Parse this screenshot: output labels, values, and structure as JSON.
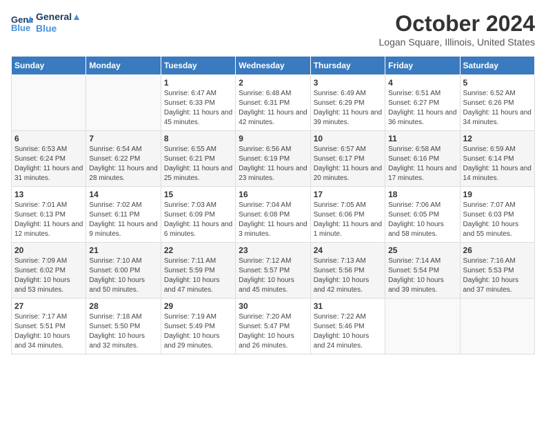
{
  "header": {
    "logo_line1": "General",
    "logo_line2": "Blue",
    "month": "October 2024",
    "location": "Logan Square, Illinois, United States"
  },
  "days_of_week": [
    "Sunday",
    "Monday",
    "Tuesday",
    "Wednesday",
    "Thursday",
    "Friday",
    "Saturday"
  ],
  "weeks": [
    [
      {
        "day": "",
        "info": ""
      },
      {
        "day": "",
        "info": ""
      },
      {
        "day": "1",
        "info": "Sunrise: 6:47 AM\nSunset: 6:33 PM\nDaylight: 11 hours and 45 minutes."
      },
      {
        "day": "2",
        "info": "Sunrise: 6:48 AM\nSunset: 6:31 PM\nDaylight: 11 hours and 42 minutes."
      },
      {
        "day": "3",
        "info": "Sunrise: 6:49 AM\nSunset: 6:29 PM\nDaylight: 11 hours and 39 minutes."
      },
      {
        "day": "4",
        "info": "Sunrise: 6:51 AM\nSunset: 6:27 PM\nDaylight: 11 hours and 36 minutes."
      },
      {
        "day": "5",
        "info": "Sunrise: 6:52 AM\nSunset: 6:26 PM\nDaylight: 11 hours and 34 minutes."
      }
    ],
    [
      {
        "day": "6",
        "info": "Sunrise: 6:53 AM\nSunset: 6:24 PM\nDaylight: 11 hours and 31 minutes."
      },
      {
        "day": "7",
        "info": "Sunrise: 6:54 AM\nSunset: 6:22 PM\nDaylight: 11 hours and 28 minutes."
      },
      {
        "day": "8",
        "info": "Sunrise: 6:55 AM\nSunset: 6:21 PM\nDaylight: 11 hours and 25 minutes."
      },
      {
        "day": "9",
        "info": "Sunrise: 6:56 AM\nSunset: 6:19 PM\nDaylight: 11 hours and 23 minutes."
      },
      {
        "day": "10",
        "info": "Sunrise: 6:57 AM\nSunset: 6:17 PM\nDaylight: 11 hours and 20 minutes."
      },
      {
        "day": "11",
        "info": "Sunrise: 6:58 AM\nSunset: 6:16 PM\nDaylight: 11 hours and 17 minutes."
      },
      {
        "day": "12",
        "info": "Sunrise: 6:59 AM\nSunset: 6:14 PM\nDaylight: 11 hours and 14 minutes."
      }
    ],
    [
      {
        "day": "13",
        "info": "Sunrise: 7:01 AM\nSunset: 6:13 PM\nDaylight: 11 hours and 12 minutes."
      },
      {
        "day": "14",
        "info": "Sunrise: 7:02 AM\nSunset: 6:11 PM\nDaylight: 11 hours and 9 minutes."
      },
      {
        "day": "15",
        "info": "Sunrise: 7:03 AM\nSunset: 6:09 PM\nDaylight: 11 hours and 6 minutes."
      },
      {
        "day": "16",
        "info": "Sunrise: 7:04 AM\nSunset: 6:08 PM\nDaylight: 11 hours and 3 minutes."
      },
      {
        "day": "17",
        "info": "Sunrise: 7:05 AM\nSunset: 6:06 PM\nDaylight: 11 hours and 1 minute."
      },
      {
        "day": "18",
        "info": "Sunrise: 7:06 AM\nSunset: 6:05 PM\nDaylight: 10 hours and 58 minutes."
      },
      {
        "day": "19",
        "info": "Sunrise: 7:07 AM\nSunset: 6:03 PM\nDaylight: 10 hours and 55 minutes."
      }
    ],
    [
      {
        "day": "20",
        "info": "Sunrise: 7:09 AM\nSunset: 6:02 PM\nDaylight: 10 hours and 53 minutes."
      },
      {
        "day": "21",
        "info": "Sunrise: 7:10 AM\nSunset: 6:00 PM\nDaylight: 10 hours and 50 minutes."
      },
      {
        "day": "22",
        "info": "Sunrise: 7:11 AM\nSunset: 5:59 PM\nDaylight: 10 hours and 47 minutes."
      },
      {
        "day": "23",
        "info": "Sunrise: 7:12 AM\nSunset: 5:57 PM\nDaylight: 10 hours and 45 minutes."
      },
      {
        "day": "24",
        "info": "Sunrise: 7:13 AM\nSunset: 5:56 PM\nDaylight: 10 hours and 42 minutes."
      },
      {
        "day": "25",
        "info": "Sunrise: 7:14 AM\nSunset: 5:54 PM\nDaylight: 10 hours and 39 minutes."
      },
      {
        "day": "26",
        "info": "Sunrise: 7:16 AM\nSunset: 5:53 PM\nDaylight: 10 hours and 37 minutes."
      }
    ],
    [
      {
        "day": "27",
        "info": "Sunrise: 7:17 AM\nSunset: 5:51 PM\nDaylight: 10 hours and 34 minutes."
      },
      {
        "day": "28",
        "info": "Sunrise: 7:18 AM\nSunset: 5:50 PM\nDaylight: 10 hours and 32 minutes."
      },
      {
        "day": "29",
        "info": "Sunrise: 7:19 AM\nSunset: 5:49 PM\nDaylight: 10 hours and 29 minutes."
      },
      {
        "day": "30",
        "info": "Sunrise: 7:20 AM\nSunset: 5:47 PM\nDaylight: 10 hours and 26 minutes."
      },
      {
        "day": "31",
        "info": "Sunrise: 7:22 AM\nSunset: 5:46 PM\nDaylight: 10 hours and 24 minutes."
      },
      {
        "day": "",
        "info": ""
      },
      {
        "day": "",
        "info": ""
      }
    ]
  ]
}
